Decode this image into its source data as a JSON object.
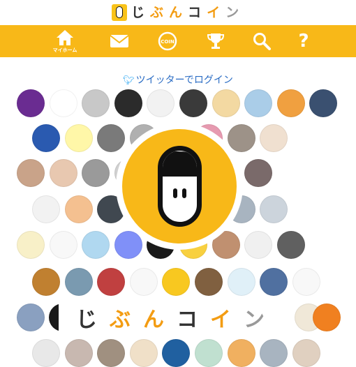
{
  "header": {
    "logo_chars": [
      {
        "text": "じ",
        "color": "#333333"
      },
      {
        "text": "ぶ",
        "color": "#f39c12"
      },
      {
        "text": "ん",
        "color": "#f39c12"
      },
      {
        "text": "コ",
        "color": "#333333"
      },
      {
        "text": "イ",
        "color": "#f39c12"
      },
      {
        "text": "ン",
        "color": "#999999"
      }
    ]
  },
  "nav": {
    "items": [
      {
        "name": "home",
        "icon": "home-icon",
        "label": "マイホーム"
      },
      {
        "name": "mail",
        "icon": "mail-icon",
        "label": ""
      },
      {
        "name": "coin",
        "icon": "coin-icon",
        "label": "COIN"
      },
      {
        "name": "ranking",
        "icon": "trophy-icon",
        "label": ""
      },
      {
        "name": "search",
        "icon": "search-icon",
        "label": ""
      },
      {
        "name": "help",
        "icon": "help-icon",
        "label": "?"
      }
    ]
  },
  "login": {
    "label": "ツイッターでログイン",
    "icon": "twitter-icon"
  },
  "brand": {
    "chars": [
      {
        "text": "じ",
        "color": "#333333"
      },
      {
        "text": "ぶ",
        "color": "#f39c12"
      },
      {
        "text": "ん",
        "color": "#f39c12"
      },
      {
        "text": "コ",
        "color": "#333333"
      },
      {
        "text": "イ",
        "color": "#f39c12"
      },
      {
        "text": "ン",
        "color": "#999999"
      }
    ]
  },
  "avatar_colors": [
    [
      "#6a2c91",
      "#ffffff",
      "#c8c8c8",
      "#2b2b2b",
      "#f2f2f2",
      "#3a3a3a",
      "#f3d9a2",
      "#aacde8",
      "#f0a040",
      "#3a5070"
    ],
    [
      "#2a5ab0",
      "#fff7a8",
      "#7a7a7a",
      "#b0b0b0",
      "#303030",
      "#e69ab0",
      "#9d9288",
      "#f0e0d0"
    ],
    [
      "#c9a389",
      "#e8c8b0",
      "#9a9a9a",
      "#d0d0d0",
      "#4a6a50",
      "#a0b0a8",
      "#e0f0f8",
      "#7a6a6a"
    ],
    [
      "#f2f2f2",
      "#f4c090",
      "#404850",
      "#6a6a6a",
      "#b0b8c0",
      "#90a0a8",
      "#a8b4c0",
      "#ccd4dc"
    ],
    [
      "#f8f0c8",
      "#f8f8f8",
      "#b0d8f0",
      "#8090f8",
      "#1a1a1a",
      "#f8d040",
      "#c09070",
      "#f0f0f0",
      "#606060"
    ],
    [
      "#c08030",
      "#7a9ab0",
      "#c04040",
      "#f8f8f8",
      "#f8c820",
      "#806040",
      "#e0f0f8",
      "#5070a0",
      "#f8f8f8"
    ],
    [
      "#8aa0c0",
      "#1a1a1a",
      "#f0e8d8",
      "#f08020"
    ],
    [
      "#e8e8e8",
      "#c8b8b0",
      "#a09080",
      "#f0e0c8",
      "#2060a0",
      "#c0e0d0",
      "#f0b060",
      "#a8b4c0",
      "#e0d0c0"
    ]
  ]
}
